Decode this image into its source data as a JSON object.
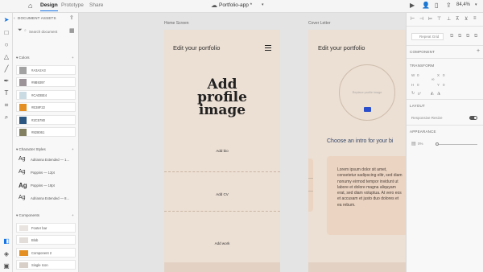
{
  "topbar": {
    "tabs": [
      "Design",
      "Prototype",
      "Share"
    ],
    "title": "Portfolio-app *",
    "zoom": "84,4%"
  },
  "assets": {
    "header": "DOCUMENT ASSETS",
    "search_placeholder": "Search document",
    "colors_label": "Colors",
    "colors": [
      {
        "hex": "#A3A2A3",
        "label": "#A3A2A3"
      },
      {
        "hex": "#9B9397",
        "label": "#9B9397"
      },
      {
        "hex": "#CADBE4",
        "label": "#CADBE4"
      },
      {
        "hex": "#E38F22",
        "label": "#E38F22"
      },
      {
        "hex": "#2C5780",
        "label": "#2C5780"
      },
      {
        "hex": "#828061",
        "label": "#828061"
      }
    ],
    "char_styles_label": "Character Styles",
    "char_styles": [
      {
        "sample": "Ag",
        "label": "Adrianna Extended — 1..."
      },
      {
        "sample": "Ag",
        "label": "Poppins — 12pt"
      },
      {
        "sample": "Ag",
        "label": "Poppins — 18pt"
      },
      {
        "sample": "Ag",
        "label": "Adrianna Extended — 8..."
      }
    ],
    "components_label": "Components",
    "components": [
      {
        "label": "Footer bar",
        "color": "#e9e4df"
      },
      {
        "label": "Blob",
        "color": "#e2ddd8"
      },
      {
        "label": "Component 2",
        "color": "#e38f22"
      },
      {
        "label": "Single Icon",
        "color": "#d7cfc8"
      }
    ]
  },
  "artboards": {
    "home": {
      "label": "Home Screen",
      "title": "Edit your portfolio",
      "heading": [
        "Add",
        "profile",
        "image"
      ],
      "add_bio": "Add bio",
      "add_cv": "Add CV",
      "add_work": "Add work"
    },
    "cover": {
      "label": "Cover Letter",
      "title": "Edit your portfolio",
      "circle_label": "Replace profile image",
      "choose": "Choose an intro for your bi",
      "lorem": "Lorem ipsum dolor sit amet, consetetur sadipscing elitr, sed diam nonumy eirmod tempor invidunt ut labore et dolore magna aliquyam erat, sed diam voluptua. At vero eos et accusam et justo duo dolores et ea rebum."
    }
  },
  "props": {
    "repeat_grid": "Repeat Grid",
    "component": "COMPONENT",
    "transform": "TRANSFORM",
    "w": "W",
    "w_val": "0",
    "x": "X",
    "x_val": "0",
    "h": "H",
    "h_val": "0",
    "y": "Y",
    "y_val": "0",
    "rot_val": "0°",
    "layout": "LAYOUT",
    "responsive_resize": "Responsive Resize",
    "appearance": "APPEARANCE",
    "opacity": "0%"
  }
}
